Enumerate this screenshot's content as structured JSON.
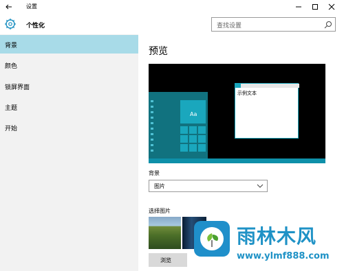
{
  "window": {
    "title": "设置",
    "minimize_icon": "minimize-icon",
    "maximize_icon": "maximize-icon",
    "close_icon": "close-icon"
  },
  "header": {
    "title": "个性化",
    "search_placeholder": "查找设置",
    "search_icon": "search-icon",
    "gear_icon": "gear-icon"
  },
  "sidebar": {
    "items": [
      {
        "label": "背景",
        "active": true
      },
      {
        "label": "颜色",
        "active": false
      },
      {
        "label": "锁屏界面",
        "active": false
      },
      {
        "label": "主题",
        "active": false
      },
      {
        "label": "开始",
        "active": false
      }
    ]
  },
  "main": {
    "section_title": "预览",
    "preview": {
      "tile_text": "Aa",
      "window_text": "示例文本"
    },
    "background_label": "背景",
    "background_value": "图片",
    "choose_picture_label": "选择图片",
    "browse_button": "浏览"
  },
  "watermark": {
    "title": "雨林木风",
    "url": "www.ylmf888.com"
  },
  "colors": {
    "accent": "#a8dbe8",
    "preview_teal": "#1aa7bd",
    "watermark_blue": "#1f92c6"
  }
}
